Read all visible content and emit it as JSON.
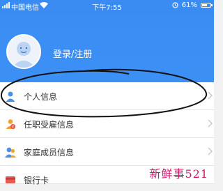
{
  "status_bar": {
    "carrier": "中国电信",
    "time": "下午7:55",
    "battery_percent": "61%",
    "battery_level": 0.61
  },
  "profile": {
    "login_label": "登录/注册",
    "avatar_icon": "default-avatar-icon"
  },
  "menu": {
    "items": [
      {
        "label": "个人信息",
        "icon": "person-icon"
      },
      {
        "label": "任职受雇信息",
        "icon": "employment-icon"
      },
      {
        "label": "家庭成员信息",
        "icon": "family-icon"
      },
      {
        "label": "银行卡",
        "icon": "bank-card-icon"
      }
    ]
  },
  "watermark": "新鲜事521",
  "colors": {
    "header_blue": "#3a8cf2",
    "icon_blue": "#4c8fe6",
    "icon_orange": "#f0a32a",
    "icon_red": "#e85a4f",
    "watermark": "#d2146b"
  }
}
